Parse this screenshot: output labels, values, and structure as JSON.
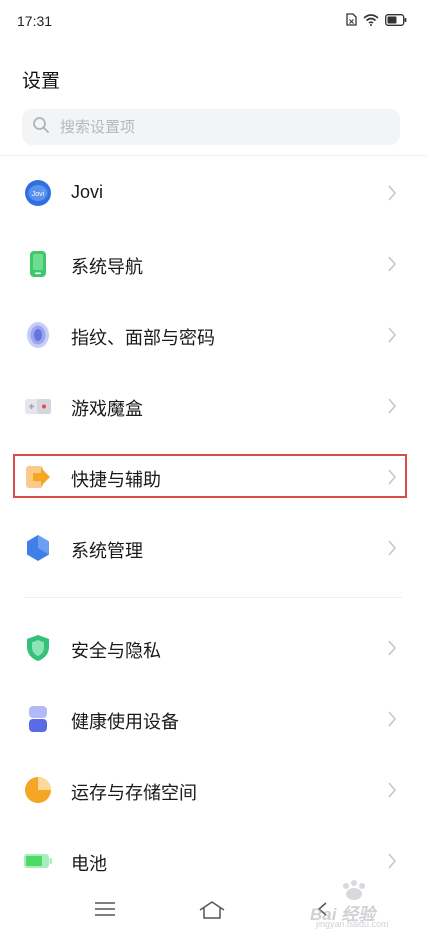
{
  "status_bar": {
    "time": "17:31"
  },
  "header": {
    "title": "设置"
  },
  "search": {
    "placeholder": "搜索设置项",
    "value": ""
  },
  "settings": {
    "items": [
      {
        "label": "Jovi",
        "icon": "jovi-icon"
      },
      {
        "label": "系统导航",
        "icon": "phone-navigation-icon"
      },
      {
        "label": "指纹、面部与密码",
        "icon": "fingerprint-icon"
      },
      {
        "label": "游戏魔盒",
        "icon": "game-box-icon"
      },
      {
        "label": "快捷与辅助",
        "icon": "shortcut-arrow-icon",
        "highlighted": true
      },
      {
        "label": "系统管理",
        "icon": "hexagon-icon"
      },
      {
        "label": "安全与隐私",
        "icon": "shield-icon"
      },
      {
        "label": "健康使用设备",
        "icon": "hourglass-icon"
      },
      {
        "label": "运存与存储空间",
        "icon": "pie-chart-icon"
      },
      {
        "label": "电池",
        "icon": "battery-icon"
      }
    ]
  },
  "colors": {
    "highlight_border": "#d94a4a",
    "jovi_blue": "#2f6fe0",
    "nav_green": "#3cc96a",
    "fingerprint_purple": "#7b86e6",
    "shortcut_orange": "#f5a623",
    "hexagon_blue": "#3f7fe8",
    "shield_green": "#34c27a",
    "battery_green": "#4cd964"
  },
  "watermark": {
    "text": "Bai 经验",
    "sub": "jingyan.baidu.com"
  }
}
